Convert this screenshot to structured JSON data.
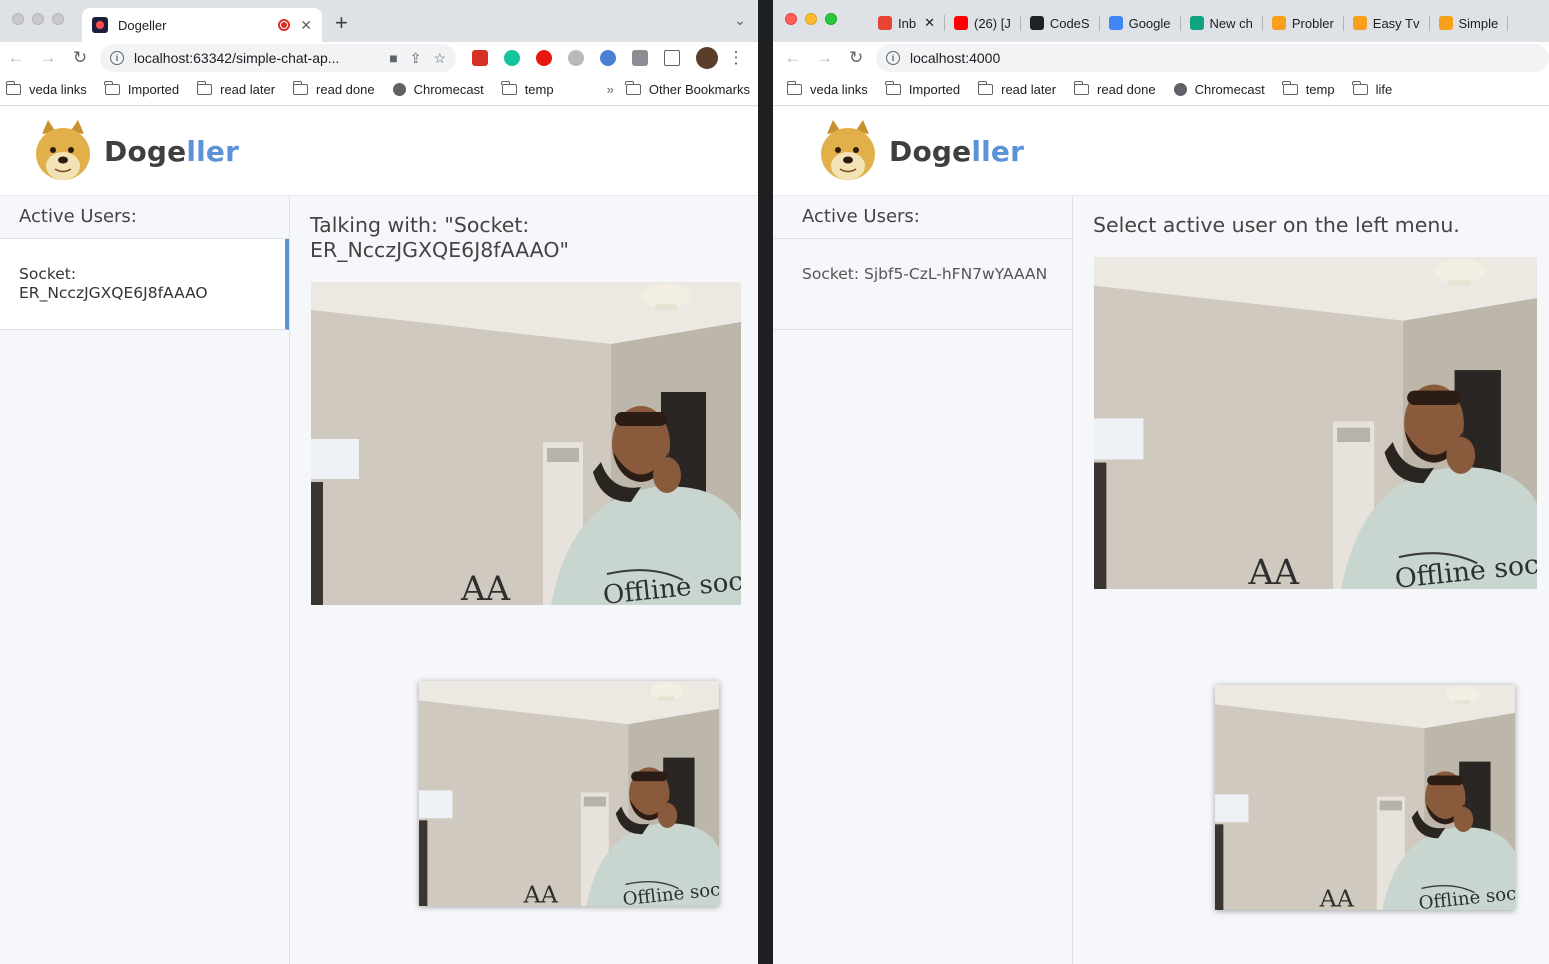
{
  "left": {
    "tab_title": "Dogeller",
    "url": "localhost:63342/simple-chat-ap...",
    "bookmarks": [
      "veda links",
      "Imported",
      "read later",
      "read done",
      "Chromecast",
      "temp"
    ],
    "bookmarks_more": "»",
    "other_bookmarks": "Other Bookmarks",
    "brand_part1": "Doge",
    "brand_part2": "ller",
    "sidebar_title": "Active Users:",
    "user": "Socket: ER_NcczJGXQE6J8fAAAO",
    "main_title": "Talking with: \"Socket: ER_NcczJGXQE6J8fAAAO\""
  },
  "right": {
    "tabs": [
      {
        "label": "Inb",
        "color": "#ea4335"
      },
      {
        "label": "(26) [J",
        "color": "#ff0000"
      },
      {
        "label": "CodeS",
        "color": "#202124"
      },
      {
        "label": "Google",
        "color": "#4285f4"
      },
      {
        "label": "New ch",
        "color": "#10a37f"
      },
      {
        "label": "Probler",
        "color": "#f89f1b"
      },
      {
        "label": "Easy Tv",
        "color": "#f89f1b"
      },
      {
        "label": "Simple",
        "color": "#f89f1b"
      }
    ],
    "url": "localhost:4000",
    "bookmarks": [
      "veda links",
      "Imported",
      "read later",
      "read done",
      "Chromecast",
      "temp",
      "life"
    ],
    "brand_part1": "Doge",
    "brand_part2": "ller",
    "sidebar_title": "Active Users:",
    "user": "Socket: Sjbf5-CzL-hFN7wYAAAN",
    "main_title": "Select active user on the left menu."
  },
  "video_text": "Offline soc",
  "video_letters": "AA"
}
